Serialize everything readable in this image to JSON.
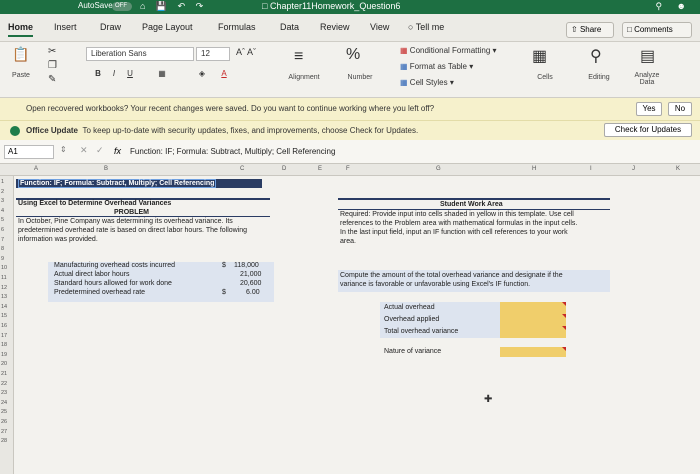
{
  "titlebar": {
    "autosave": "AutoSave",
    "toggle": "OFF",
    "document": "Chapter11Homework_Question6"
  },
  "tabs": [
    "Home",
    "Insert",
    "Draw",
    "Page Layout",
    "Formulas",
    "Data",
    "Review",
    "View"
  ],
  "tell_me": "Tell me",
  "share": "Share",
  "comments": "Comments",
  "ribbon": {
    "paste": "Paste",
    "font_name": "Liberation Sans",
    "font_size": "12",
    "alignment": "Alignment",
    "number": "Number",
    "conditional_formatting": "Conditional Formatting",
    "format_as_table": "Format as Table",
    "cell_styles": "Cell Styles",
    "cells": "Cells",
    "editing": "Editing",
    "analyze_data": "Analyze Data"
  },
  "recovery": {
    "message": "Open recovered workbooks? Your recent changes were saved. Do you want to continue working where you left off?",
    "yes": "Yes",
    "no": "No"
  },
  "update": {
    "title": "Office Update",
    "message": "To keep up-to-date with security updates, fixes, and improvements, choose Check for Updates.",
    "button": "Check for Updates"
  },
  "formula_bar": {
    "name_box": "A1",
    "fx": "fx",
    "content": "Function: IF; Formula: Subtract, Multiply; Cell Referencing"
  },
  "columns": [
    "A",
    "B",
    "C",
    "D",
    "E",
    "F",
    "G",
    "H",
    "I",
    "J",
    "K"
  ],
  "rows": [
    "1",
    "2",
    "3",
    "4",
    "5",
    "6",
    "7",
    "8",
    "9",
    "10",
    "11",
    "12",
    "13",
    "14",
    "15",
    "16",
    "17",
    "18",
    "19",
    "20",
    "21",
    "22",
    "23",
    "24",
    "25",
    "26",
    "27",
    "28"
  ],
  "sheet": {
    "a1": "Function: IF; Formula: Subtract, Multiply; Cell Referencing",
    "a3": "Using Excel to Determine Overhead Variances",
    "problem": "PROBLEM",
    "problem_text": [
      "In October, Pine Company was determining its overhead variance. Its",
      "predetermined overhead rate is based on direct labor hours. The following",
      "information was provided."
    ],
    "items": [
      {
        "label": "Manufacturing overhead costs incurred",
        "currency": "$",
        "value": "118,000"
      },
      {
        "label": "Actual direct labor hours",
        "currency": "",
        "value": "21,000"
      },
      {
        "label": "Standard hours allowed for work done",
        "currency": "",
        "value": "20,600"
      },
      {
        "label": "Predetermined overhead rate",
        "currency": "$",
        "value": "6.00"
      }
    ],
    "student_area": "Student Work Area",
    "student_text": [
      "Required: Provide input into cells shaded in yellow in this template. Use cell",
      "references to the Problem area with mathematical formulas in the input cells.",
      "In the last input field, input an IF function with cell references to your work",
      "area."
    ],
    "compute_text": [
      "Compute the amount of the total overhead variance and designate if the",
      "variance is favorable or unfavorable using Excel's IF function."
    ],
    "outputs": [
      "Actual overhead",
      "Overhead applied",
      "Total overhead variance",
      "Nature of variance"
    ]
  }
}
